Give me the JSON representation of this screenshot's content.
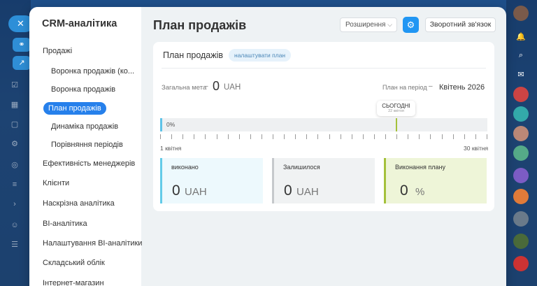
{
  "sidebar": {
    "title": "CRM-аналітика",
    "items": [
      {
        "label": "Продажі",
        "level": 0
      },
      {
        "label": "Воронка продажів (ко...",
        "level": 1
      },
      {
        "label": "Воронка продажів",
        "level": 1
      },
      {
        "label": "План продажів",
        "level": 1,
        "active": true
      },
      {
        "label": "Динаміка продажів",
        "level": 1
      },
      {
        "label": "Порівняння періодів",
        "level": 1
      },
      {
        "label": "Ефективність менеджерів",
        "level": 0
      },
      {
        "label": "Клієнти",
        "level": 0
      },
      {
        "label": "Наскрізна аналітика",
        "level": 0
      },
      {
        "label": "BI-аналітика",
        "level": 0
      },
      {
        "label": "Налаштування BI-аналітики",
        "level": 0
      },
      {
        "label": "Складський облік",
        "level": 0
      },
      {
        "label": "Інтернет-магазин",
        "level": 0
      }
    ]
  },
  "header": {
    "title": "План продажів",
    "extensions_label": "Розширення",
    "feedback_label": "Зворотний зв'язок"
  },
  "card": {
    "title": "План продажів",
    "configure_label": "налаштувати план",
    "goal_label": "Загальна мета",
    "goal_value": "0",
    "goal_unit": "UAH",
    "period_label": "План на період",
    "period_value": "Квітень 2026",
    "today_label": "СЬОГОДНІ",
    "today_date": "22 квітня",
    "progress_text": "0%",
    "progress_value": 0,
    "today_position": 0.72,
    "range_start": "1 квітня",
    "range_end": "30 квітня"
  },
  "stats": {
    "done": {
      "label": "виконано",
      "value": "0",
      "unit": "UAH",
      "color": "#63cbe8"
    },
    "remaining": {
      "label": "Залишилося",
      "value": "0",
      "unit": "UAH",
      "color": "#c6c9cc"
    },
    "plan": {
      "label": "Виконання плану",
      "value": "0",
      "unit": "%",
      "color": "#a4c13b"
    }
  },
  "icons": {
    "close": "close-icon",
    "gear": "gear-icon",
    "chevron": "chevron-down-icon"
  },
  "colors": {
    "accent": "#2680eb",
    "background": "#2a5d97"
  }
}
